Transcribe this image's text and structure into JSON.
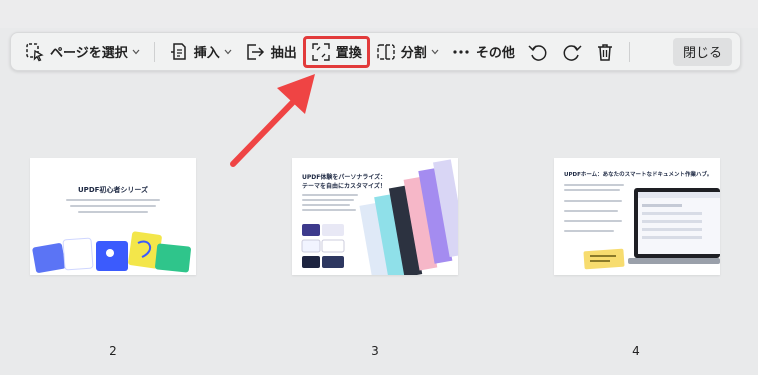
{
  "toolbar": {
    "select_page": "ページを選択",
    "insert": "挿入",
    "extract": "抽出",
    "replace": "置換",
    "split": "分割",
    "more": "その他",
    "close": "閉じる"
  },
  "pages": [
    {
      "number": "2",
      "title": "UPDF初心者シリーズ"
    },
    {
      "number": "3",
      "title_line1": "UPDF体験をパーソナライズ：",
      "title_line2": "テーマを自由にカスタマイズ！"
    },
    {
      "number": "4",
      "title": "UPDFホーム：あなたのスマートなドキュメント作業ハブ。"
    }
  ],
  "colors": {
    "highlight": "#e23b3b",
    "arrow": "#ef4444"
  }
}
